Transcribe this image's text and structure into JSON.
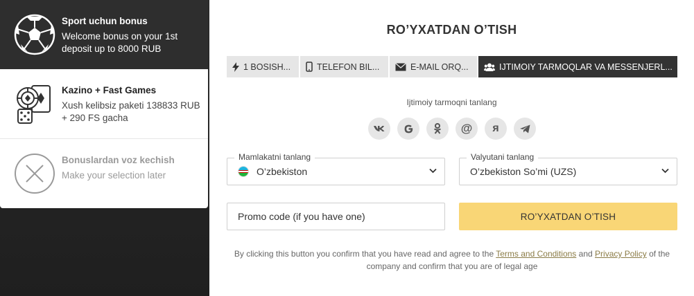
{
  "bonuses": [
    {
      "title": "Sport uchun bonus",
      "description": "Welcome bonus on your 1st deposit up to 8000 RUB",
      "icon": "soccer-ball-icon"
    },
    {
      "title": "Kazino + Fast Games",
      "description": "Xush kelibsiz paketi 138833 RUB + 290 FS gacha",
      "icon": "casino-chips-cards-dice-icon"
    },
    {
      "title": "Bonuslardan voz kechish",
      "description": "Make your selection later",
      "icon": "decline-x-icon"
    }
  ],
  "form": {
    "title": "RO’YXATDAN O’TISH",
    "tabs": [
      {
        "label": "1 BOSISH...",
        "icon": "lightning-icon",
        "active": false
      },
      {
        "label": "TELEFON BIL...",
        "icon": "phone-icon",
        "active": false
      },
      {
        "label": "E-MAIL ORQ...",
        "icon": "envelope-icon",
        "active": false
      },
      {
        "label": "IJTIMOIY TARMOQLAR VA MESSENJERL...",
        "icon": "users-icon",
        "active": true
      }
    ],
    "social_label": "Ijtimoiy tarmoqni tanlang",
    "social": [
      {
        "label": "vk",
        "icon": "vk-icon"
      },
      {
        "label": "G",
        "icon": "google-icon"
      },
      {
        "label": "ok",
        "icon": "odnoklassniki-icon"
      },
      {
        "label": "@",
        "icon": "mail-ru-icon"
      },
      {
        "label": "я",
        "icon": "yandex-icon"
      },
      {
        "label": "tg",
        "icon": "telegram-icon"
      }
    ],
    "country": {
      "label": "Mamlakatni tanlang",
      "value": "O’zbekiston"
    },
    "currency": {
      "label": "Valyutani tanlang",
      "value": "O’zbekiston So’mi (UZS)"
    },
    "promo": {
      "placeholder": "Promo code (if you have one)",
      "value": ""
    },
    "submit_label": "RO’YXATDAN O’TISH",
    "legal": {
      "prefix": "By clicking this button you confirm that you have read and agree to the",
      "terms": "Terms and Conditions",
      "and": "and",
      "privacy": "Privacy Policy",
      "suffix": "of the company and confirm that you are of legal age"
    }
  },
  "colors": {
    "dark_panel": "#2e2e2e",
    "active_tab": "#333333",
    "tab_bg": "#e6e6e6",
    "submit_bg": "#f9d676",
    "link": "#8a7b45"
  }
}
